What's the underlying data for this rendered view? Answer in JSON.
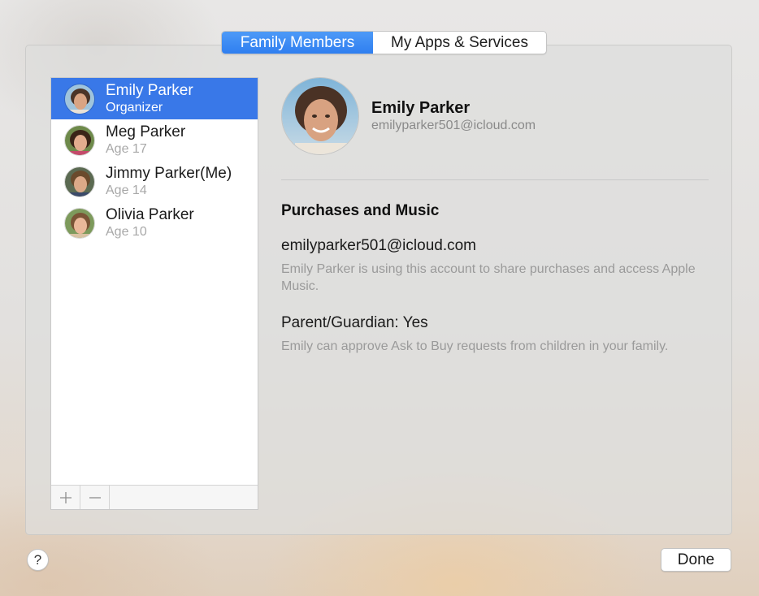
{
  "tabs": {
    "family_members": "Family Members",
    "apps_services": "My Apps & Services"
  },
  "members": [
    {
      "name": "Emily Parker",
      "subtitle": "Organizer",
      "selected": true
    },
    {
      "name": "Meg Parker",
      "subtitle": "Age 17",
      "selected": false
    },
    {
      "name": "Jimmy Parker(Me)",
      "subtitle": "Age 14",
      "selected": false
    },
    {
      "name": "Olivia Parker",
      "subtitle": "Age 10",
      "selected": false
    }
  ],
  "list_footer": {
    "add_icon": "plus-icon",
    "remove_icon": "minus-icon"
  },
  "detail": {
    "name": "Emily Parker",
    "email": "emilyparker501@icloud.com",
    "section_title": "Purchases and Music",
    "account": "emilyparker501@icloud.com",
    "account_desc": "Emily Parker is using this account to share purchases and access Apple Music.",
    "guardian": "Parent/Guardian: Yes",
    "guardian_desc": "Emily can approve Ask to Buy requests from children in your family."
  },
  "footer": {
    "help": "?",
    "done": "Done"
  },
  "colors": {
    "accent": "#3978e8",
    "secondary_text": "#9a9a9a"
  }
}
